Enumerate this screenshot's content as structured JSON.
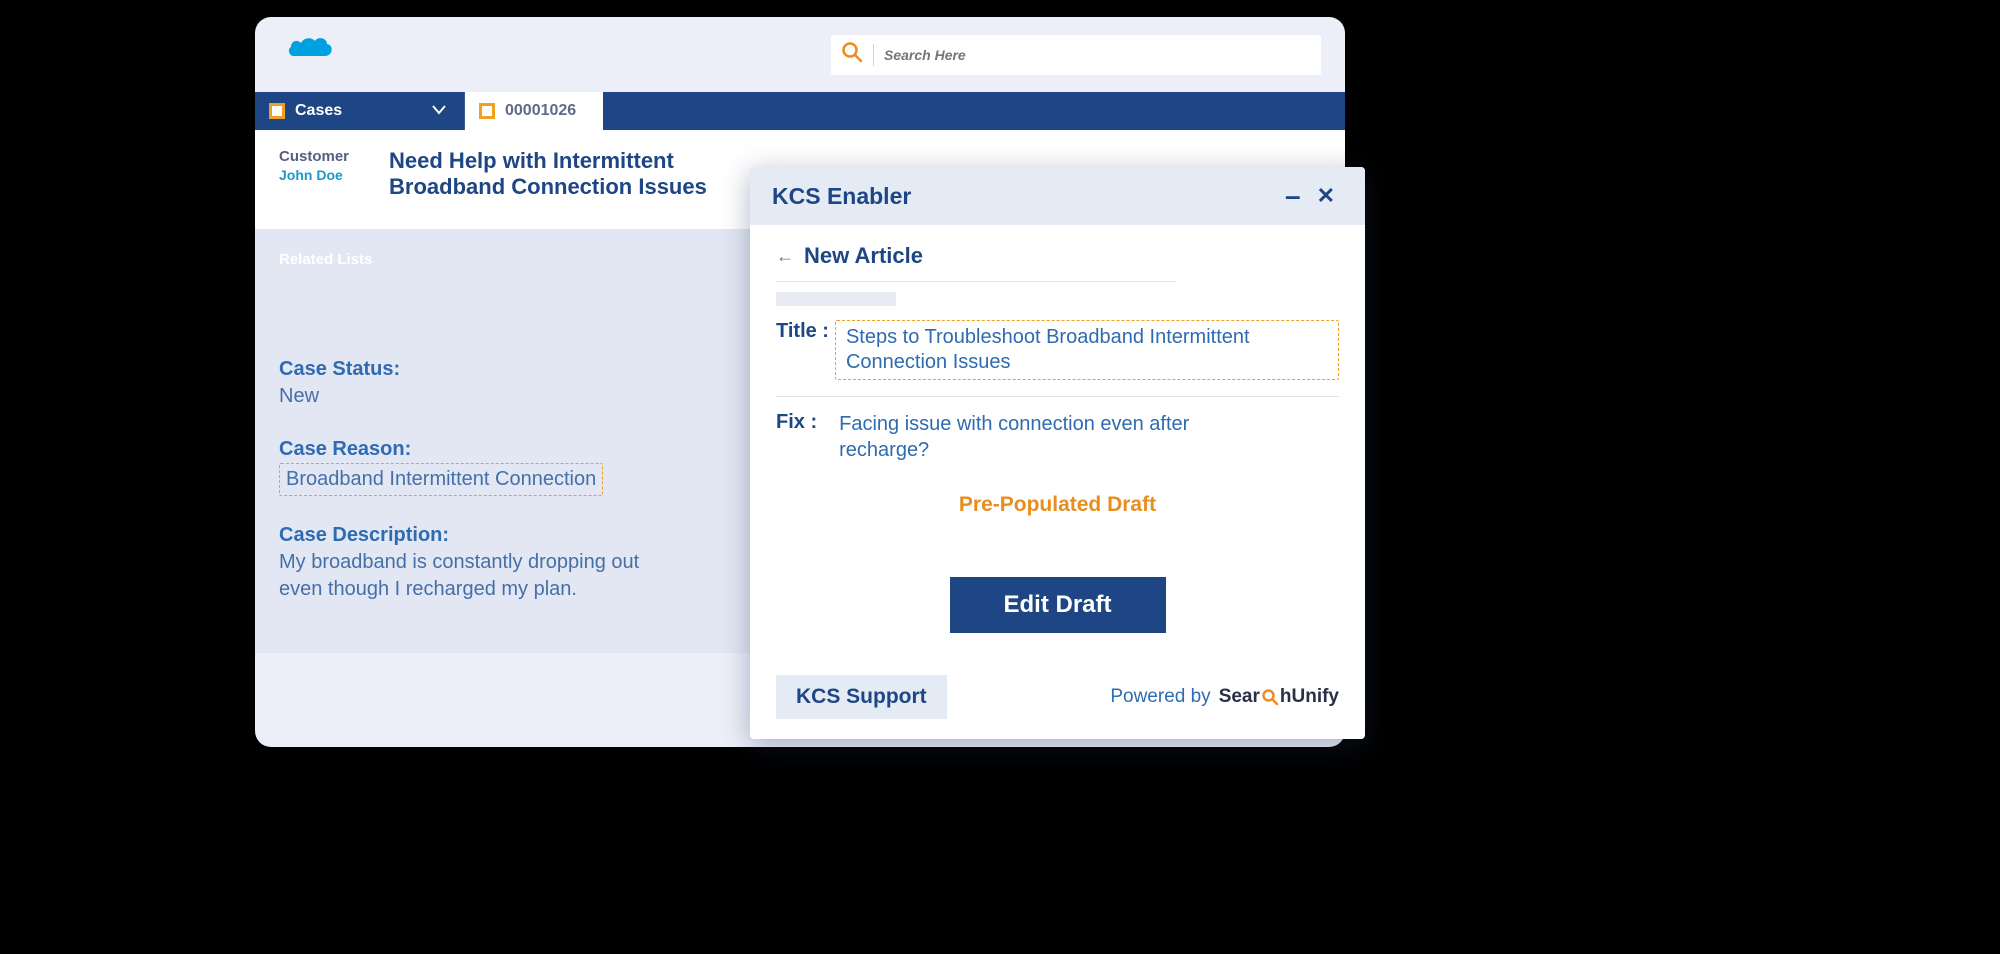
{
  "search": {
    "placeholder": "Search Here"
  },
  "tabs": {
    "cases": "Cases",
    "caseNumber": "00001026"
  },
  "customer": {
    "label": "Customer",
    "name": "John Doe"
  },
  "caseSubject": "Need Help with Intermittent Broadband Connection Issues",
  "relatedLists": "Related Lists",
  "fields": {
    "statusLabel": "Case Status:",
    "statusValue": "New",
    "reasonLabel": "Case Reason:",
    "reasonValue": "Broadband Intermittent Connection",
    "descLabel": "Case Description:",
    "descValue": "My broadband is constantly  dropping out even though I recharged my plan."
  },
  "kcs": {
    "header": "KCS Enabler",
    "newArticle": "New Article",
    "titleLabel": "Title :",
    "titleValue": "Steps to Troubleshoot Broadband Intermittent Connection Issues",
    "fixLabel": "Fix :",
    "fixValue": "Facing issue with connection even after recharge?",
    "prepopulated": "Pre-Populated Draft",
    "editDraft": "Edit Draft",
    "support": "KCS Support",
    "poweredBy": "Powered by",
    "logoPre": "Sear",
    "logoPost": "hUnify"
  }
}
